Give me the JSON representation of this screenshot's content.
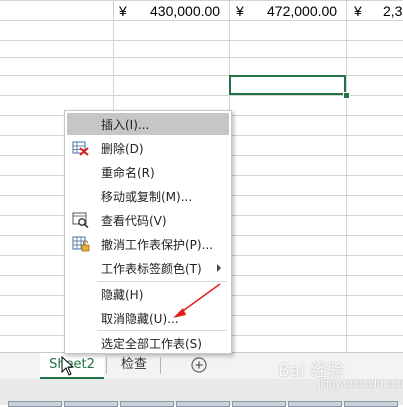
{
  "spreadsheet": {
    "row1": {
      "c1_symbol": "¥",
      "c1_value": "430,000.00",
      "c2_symbol": "¥",
      "c2_value": "472,000.00",
      "c3_symbol": "¥",
      "c3_value": "2,3"
    }
  },
  "context_menu": {
    "items": [
      {
        "label": "插入(I)...",
        "icon": ""
      },
      {
        "label": "删除(D)",
        "icon": "delete-sheet-icon"
      },
      {
        "label": "重命名(R)",
        "icon": ""
      },
      {
        "label": "移动或复制(M)...",
        "icon": ""
      },
      {
        "label": "查看代码(V)",
        "icon": "view-code-icon"
      },
      {
        "label": "撤消工作表保护(P)...",
        "icon": "unprotect-sheet-icon"
      },
      {
        "label": "工作表标签颜色(T)",
        "icon": "",
        "submenu": true
      },
      {
        "label": "隐藏(H)",
        "icon": ""
      },
      {
        "label": "取消隐藏(U)...",
        "icon": ""
      },
      {
        "label": "选定全部工作表(S)",
        "icon": ""
      }
    ]
  },
  "sheet_tabs": {
    "active": "Sheet2",
    "other": "检查",
    "add_icon": "plus-circle-icon"
  },
  "watermark": {
    "text": "Bai 经验",
    "sub": "jingyan.baidu.com"
  },
  "colors": {
    "accent": "#217346",
    "menu_hover": "#c6c6c6",
    "annotation_arrow": "#e02020"
  }
}
